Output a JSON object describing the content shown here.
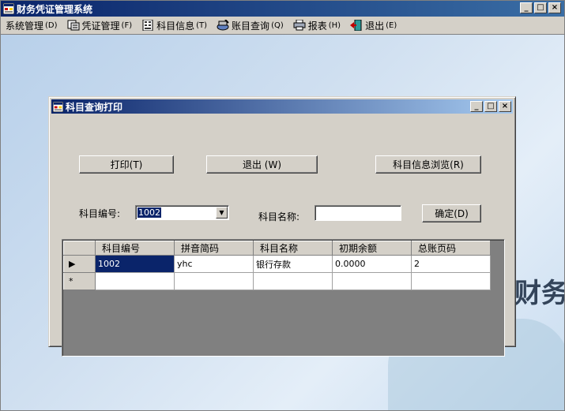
{
  "window": {
    "title": "财务凭证管理系统",
    "controls": {
      "minimize": "_",
      "maximize": "□",
      "close": "×"
    }
  },
  "menu": {
    "items": [
      {
        "label": "系统管理",
        "hotkey": "(D)",
        "icon": ""
      },
      {
        "label": "凭证管理",
        "hotkey": "(F)",
        "icon": "voucher-icon"
      },
      {
        "label": "科目信息",
        "hotkey": "(T)",
        "icon": "account-info-icon"
      },
      {
        "label": "账目查询",
        "hotkey": "(Q)",
        "icon": "query-icon"
      },
      {
        "label": "报表",
        "hotkey": "(H)",
        "icon": "printer-icon"
      },
      {
        "label": "退出",
        "hotkey": "(E)",
        "icon": "exit-door-icon"
      }
    ]
  },
  "watermark": {
    "text": "财务凭"
  },
  "child": {
    "title": "科目查询打印",
    "buttons": {
      "print": "打印(T)",
      "exit": "退出 (W)",
      "browse": "科目信息浏览(R)",
      "confirm": "确定(D)"
    },
    "labels": {
      "account_code": "科目编号:",
      "account_name": "科目名称:"
    },
    "combo_value": "1002",
    "name_value": "",
    "grid": {
      "columns": [
        "科目编号",
        "拼音简码",
        "科目名称",
        "初期余额",
        "总账页码"
      ],
      "rows": [
        {
          "indicator": "▶",
          "cells": [
            "1002",
            "yhc",
            "银行存款",
            "0.0000",
            "2"
          ]
        },
        {
          "indicator": "*",
          "cells": [
            "",
            "",
            "",
            "",
            ""
          ]
        }
      ]
    }
  },
  "colors": {
    "title_bar": "#0a246a",
    "face": "#d4d0c8",
    "selection": "#0a246a"
  }
}
